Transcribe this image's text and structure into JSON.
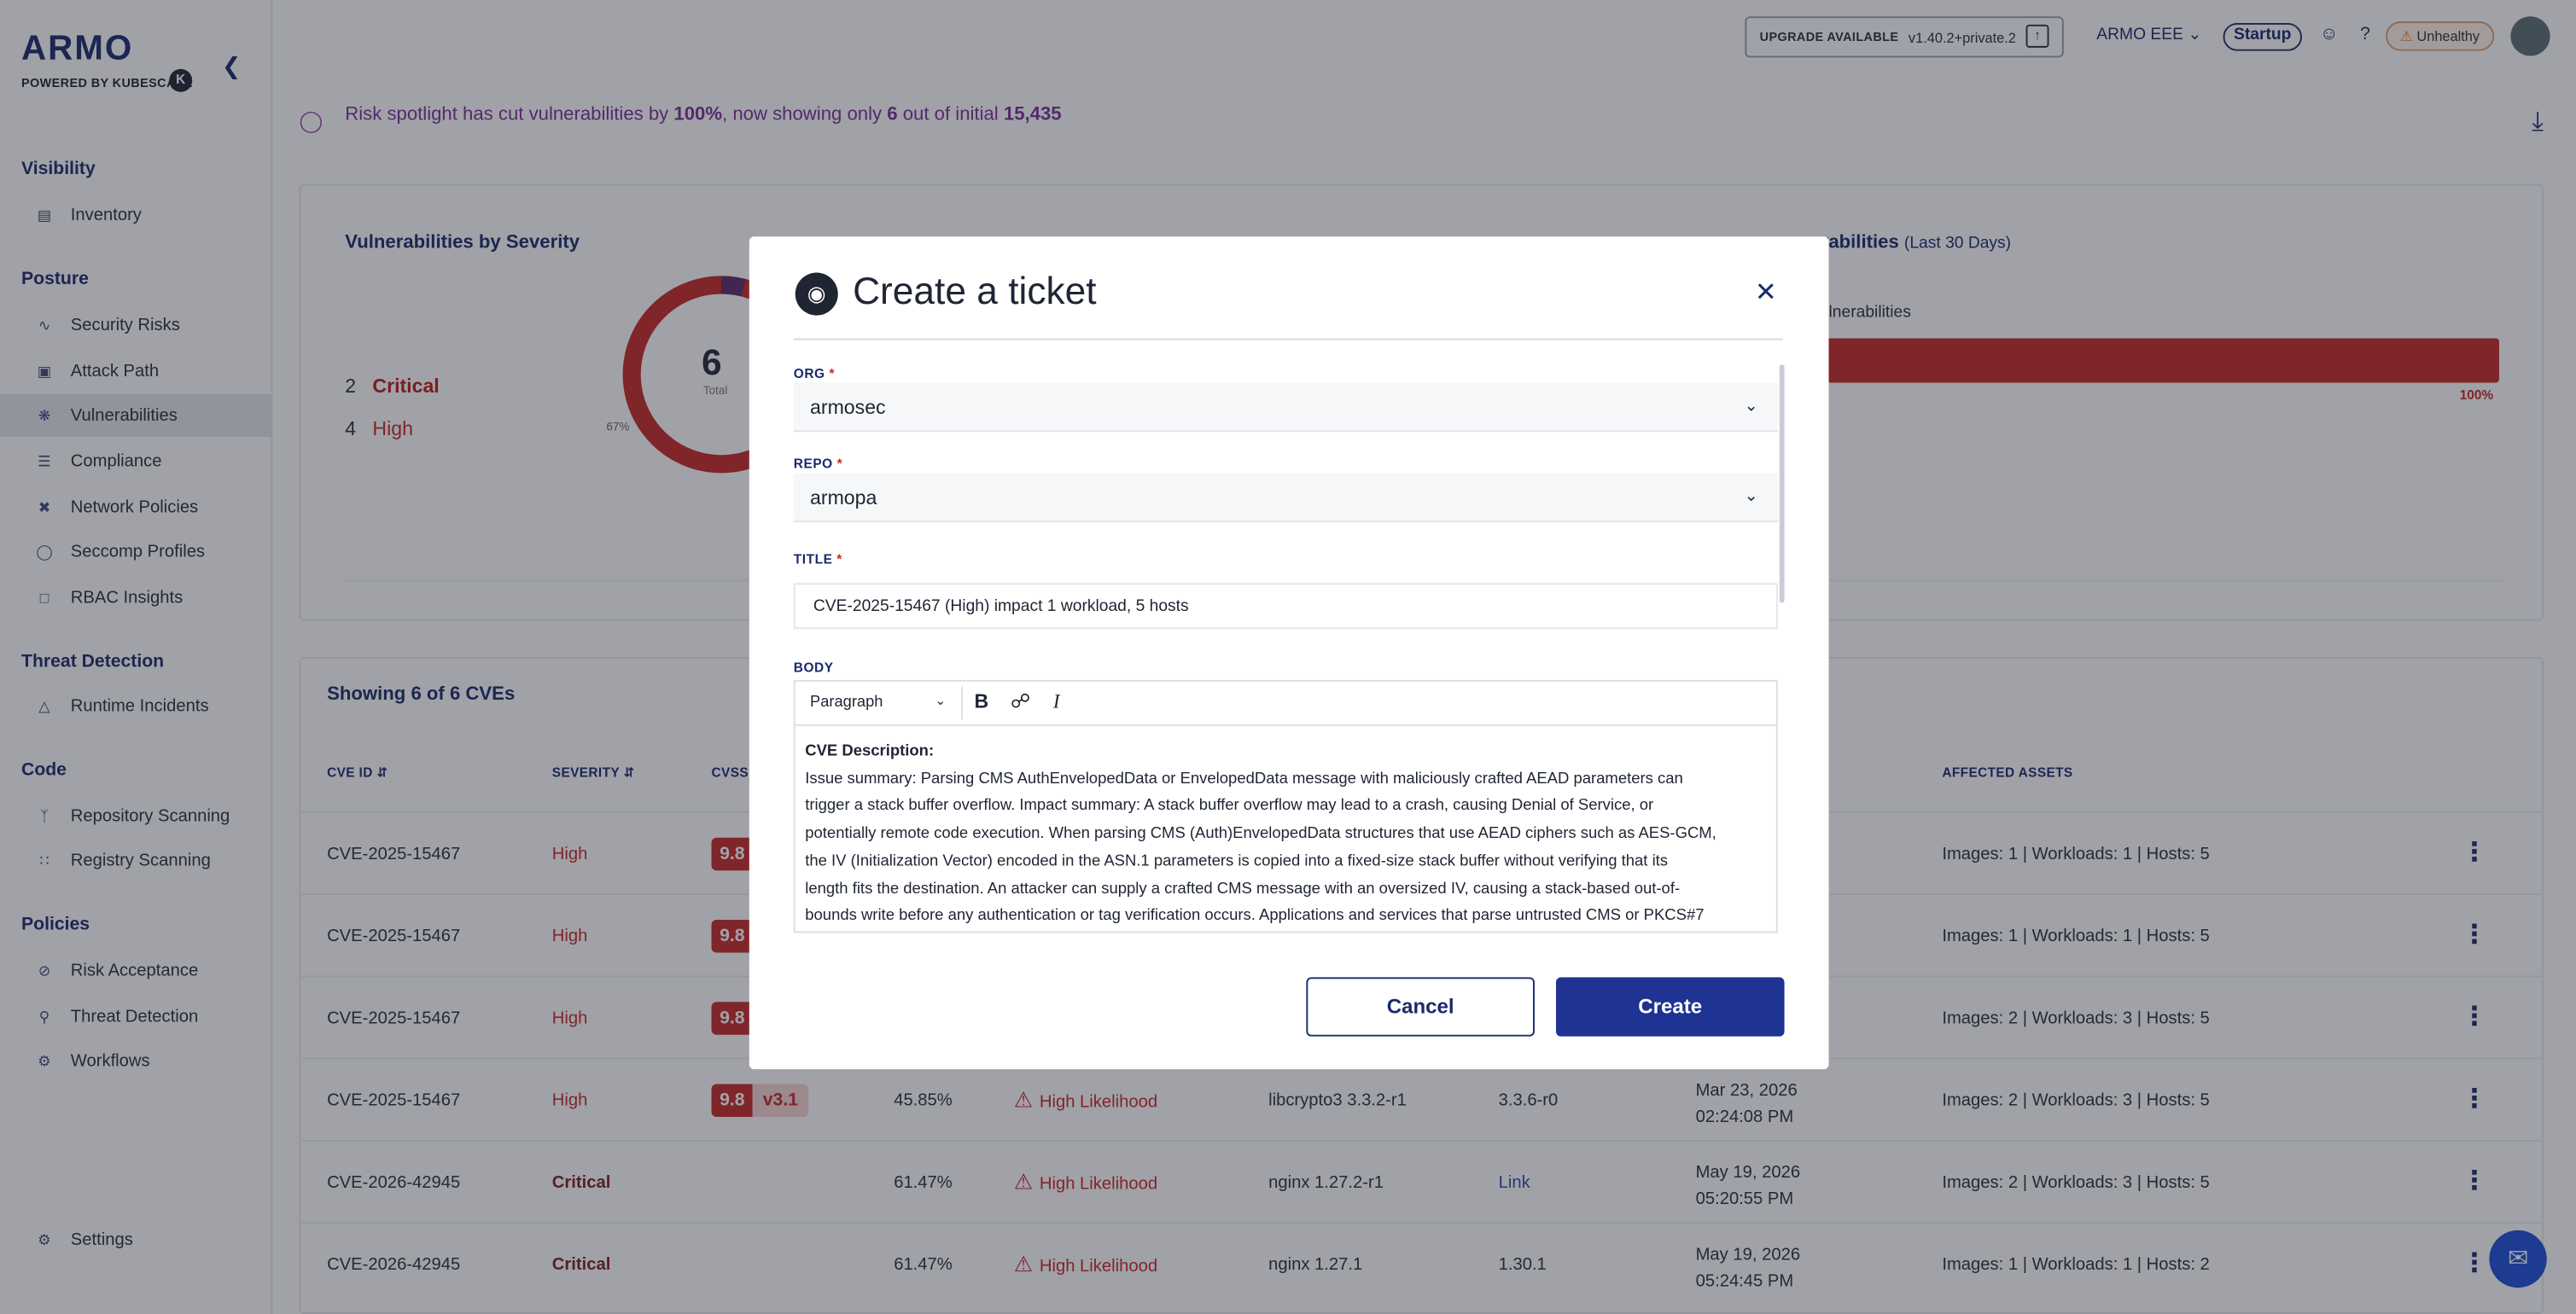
{
  "brand": {
    "logo": "ARMO",
    "powered_by": "POWERED BY KUBESCAPE",
    "k_badge": "K"
  },
  "topbar": {
    "upgrade_label": "UPGRADE AVAILABLE",
    "version": "v1.40.2+private.2",
    "org": "ARMO EEE",
    "plan": "Startup",
    "health": "Unhealthy"
  },
  "sidebar": {
    "sections": [
      {
        "title": "Visibility",
        "items": [
          {
            "label": "Inventory",
            "icon": "inventory-icon"
          }
        ]
      },
      {
        "title": "Posture",
        "items": [
          {
            "label": "Security Risks",
            "icon": "chart-icon"
          },
          {
            "label": "Attack Path",
            "icon": "lock-icon"
          },
          {
            "label": "Vulnerabilities",
            "icon": "bug-icon",
            "active": true
          },
          {
            "label": "Compliance",
            "icon": "checklist-icon"
          },
          {
            "label": "Network Policies",
            "icon": "network-icon"
          },
          {
            "label": "Seccomp Profiles",
            "icon": "shield-icon"
          },
          {
            "label": "RBAC Insights",
            "icon": "user-icon"
          }
        ]
      },
      {
        "title": "Threat Detection",
        "items": [
          {
            "label": "Runtime Incidents",
            "icon": "warning-icon"
          }
        ]
      },
      {
        "title": "Code",
        "items": [
          {
            "label": "Repository Scanning",
            "icon": "branch-icon"
          },
          {
            "label": "Registry Scanning",
            "icon": "grid-icon"
          }
        ]
      },
      {
        "title": "Policies",
        "items": [
          {
            "label": "Risk Acceptance",
            "icon": "eye-off-icon"
          },
          {
            "label": "Threat Detection",
            "icon": "search-icon"
          },
          {
            "label": "Workflows",
            "icon": "workflow-icon"
          }
        ]
      }
    ],
    "settings": "Settings"
  },
  "spotlight": {
    "pre": "Risk spotlight has cut vulnerabilities by ",
    "pct": "100%",
    "mid": ", now showing only ",
    "count": "6",
    "mid2": " out of initial ",
    "initial": "15,435"
  },
  "severity_card": {
    "title": "Vulnerabilities by Severity",
    "rows": [
      {
        "count": "2",
        "label": "Critical"
      },
      {
        "count": "4",
        "label": "High"
      }
    ],
    "total": "6",
    "total_label": "Total",
    "slice_pct": "67%"
  },
  "right_card": {
    "title": "nerabilities",
    "title_suffix": "(Last 30 Days)",
    "legend": "lnerabilities",
    "pct": "100%"
  },
  "table": {
    "heading": "Showing 6 of 6 CVEs",
    "columns": [
      "CVE ID",
      "SEVERITY",
      "CVSS",
      "AFFECTED ASSETS"
    ],
    "rows": [
      {
        "id": "CVE-2025-15467",
        "severity": "High",
        "cvss": "9.8",
        "assets": "Images: 1 | Workloads: 1 | Hosts: 5"
      },
      {
        "id": "CVE-2025-15467",
        "severity": "High",
        "cvss": "9.8",
        "assets": "Images: 1 | Workloads: 1 | Hosts: 5"
      },
      {
        "id": "CVE-2025-15467",
        "severity": "High",
        "cvss": "9.8",
        "assets": "Images: 2 | Workloads: 3 | Hosts: 5"
      },
      {
        "id": "CVE-2025-15467",
        "severity": "High",
        "cvss": "9.8",
        "cvss_ver": "v3.1",
        "epss": "45.85%",
        "likelihood": "High Likelihood",
        "component": "libcrypto3 3.3.2-r1",
        "fix": "3.3.6-r0",
        "date": "Mar 23, 2026",
        "time": "02:24:08 PM",
        "assets": "Images: 2 | Workloads: 3 | Hosts: 5"
      },
      {
        "id": "CVE-2026-42945",
        "severity": "Critical",
        "epss": "61.47%",
        "likelihood": "High Likelihood",
        "component": "nginx 1.27.2-r1",
        "fix": "Link",
        "date": "May 19, 2026",
        "time": "05:20:55 PM",
        "assets": "Images: 2 | Workloads: 3 | Hosts: 5"
      },
      {
        "id": "CVE-2026-42945",
        "severity": "Critical",
        "epss": "61.47%",
        "likelihood": "High Likelihood",
        "component": "nginx 1.27.1",
        "fix": "1.30.1",
        "date": "May 19, 2026",
        "time": "05:24:45 PM",
        "assets": "Images: 1 | Workloads: 1 | Hosts: 2"
      }
    ]
  },
  "modal": {
    "title": "Create a ticket",
    "org_label": "ORG",
    "org_value": "armosec",
    "repo_label": "REPO",
    "repo_value": "armopa",
    "title_label": "TITLE",
    "title_value": "CVE-2025-15467 (High) impact 1 workload, 5 hosts",
    "body_label": "BODY",
    "block_format": "Paragraph",
    "required_mark": "*",
    "body_heading": "CVE Description:",
    "body_lines": [
      "Issue summary: Parsing CMS AuthEnvelopedData or EnvelopedData message with maliciously crafted AEAD parameters can",
      "trigger a stack buffer overflow. Impact summary: A stack buffer overflow may lead to a crash, causing Denial of Service, or",
      "potentially remote code execution. When parsing CMS (Auth)EnvelopedData structures that use AEAD ciphers such as AES-GCM,",
      "the IV (Initialization Vector) encoded in the ASN.1 parameters is copied into a fixed-size stack buffer without verifying that its",
      "length fits the destination. An attacker can supply a crafted CMS message with an oversized IV, causing a stack-based out-of-",
      "bounds write before any authentication or tag verification occurs. Applications and services that parse untrusted CMS or PKCS#7"
    ],
    "cancel": "Cancel",
    "create": "Create"
  }
}
